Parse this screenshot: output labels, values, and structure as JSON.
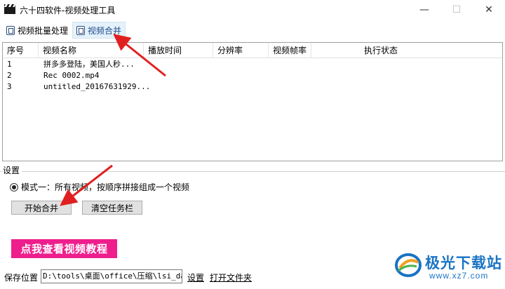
{
  "window": {
    "title": "六十四软件-视频处理工具",
    "controls": {
      "minimize": "—",
      "maximize": "☐",
      "close": "✕"
    }
  },
  "tabs": [
    {
      "label": "视频批量处理",
      "icon": "document-icon",
      "active": false
    },
    {
      "label": "视频合并",
      "icon": "document-icon",
      "active": true
    }
  ],
  "table": {
    "columns": [
      "序号",
      "视频名称",
      "播放时间",
      "分辨率",
      "视频帧率",
      "执行状态"
    ],
    "rows": [
      {
        "index": "1",
        "name": "拼多多登陆，美国人秒...",
        "duration": "",
        "resolution": "",
        "framerate": "",
        "status": ""
      },
      {
        "index": "2",
        "name": "Rec 0002.mp4",
        "duration": "",
        "resolution": "",
        "framerate": "",
        "status": ""
      },
      {
        "index": "3",
        "name": "untitled_20167631929...",
        "duration": "",
        "resolution": "",
        "framerate": "",
        "status": ""
      }
    ]
  },
  "settings": {
    "group_label": "设置",
    "mode_option": "模式一：所有视频，按顺序拼接组成一个视频",
    "mode_selected": true,
    "start_button": "开始合并",
    "clear_button": "清空任务栏"
  },
  "tutorial_button": "点我查看视频教程",
  "save": {
    "label": "保存位置",
    "path": "D:\\tools\\桌面\\office\\压缩\\lsi_data",
    "settings_link": "设置",
    "open_folder_link": "打开文件夹"
  },
  "watermark": {
    "text": "极光下载站",
    "url": "www.xz7.com"
  },
  "colors": {
    "tutorial_bg": "#ee1e8d",
    "active_tab_bg": "#e5f1fb",
    "annotation_arrow": "#e02020",
    "watermark_blue": "#1a73c4"
  }
}
